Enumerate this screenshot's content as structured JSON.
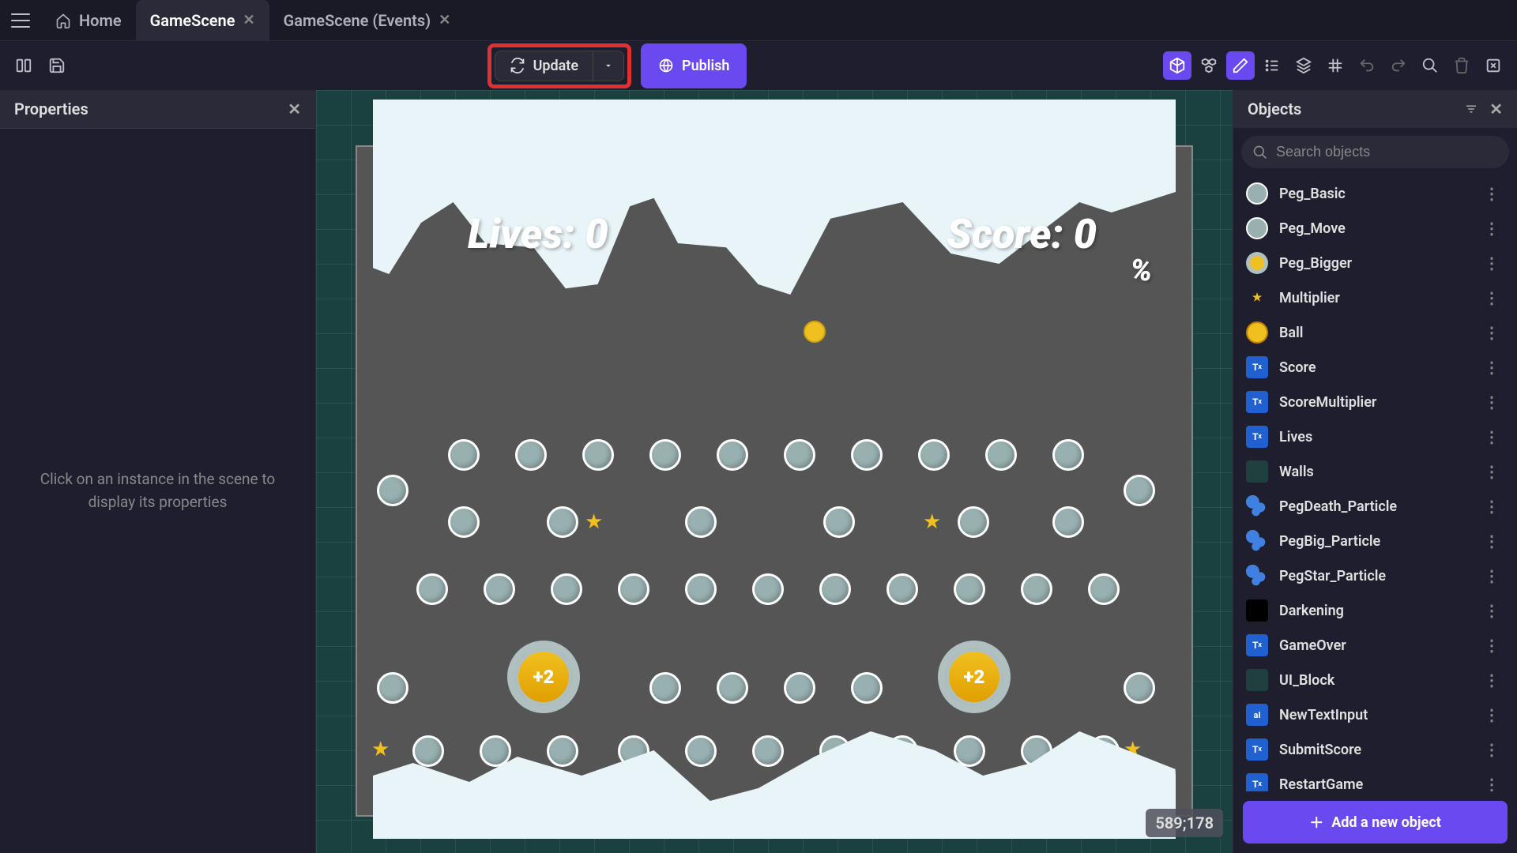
{
  "tabs": {
    "home": "Home",
    "scene": "GameScene",
    "events": "GameScene (Events)"
  },
  "toolbar": {
    "update_label": "Update",
    "publish_label": "Publish"
  },
  "properties": {
    "title": "Properties",
    "empty_hint": "Click on an instance in the scene to display its properties"
  },
  "objects_panel": {
    "title": "Objects",
    "search_placeholder": "Search objects",
    "add_label": "Add a new object",
    "items": [
      {
        "name": "Peg_Basic",
        "thumb": "peg"
      },
      {
        "name": "Peg_Move",
        "thumb": "peg"
      },
      {
        "name": "Peg_Bigger",
        "thumb": "yellow-ring"
      },
      {
        "name": "Multiplier",
        "thumb": "star"
      },
      {
        "name": "Ball",
        "thumb": "ball"
      },
      {
        "name": "Score",
        "thumb": "text"
      },
      {
        "name": "ScoreMultiplier",
        "thumb": "text"
      },
      {
        "name": "Lives",
        "thumb": "text"
      },
      {
        "name": "Walls",
        "thumb": "wall"
      },
      {
        "name": "PegDeath_Particle",
        "thumb": "particle"
      },
      {
        "name": "PegBig_Particle",
        "thumb": "particle"
      },
      {
        "name": "PegStar_Particle",
        "thumb": "particle"
      },
      {
        "name": "Darkening",
        "thumb": "dark"
      },
      {
        "name": "GameOver",
        "thumb": "text"
      },
      {
        "name": "UI_Block",
        "thumb": "wall"
      },
      {
        "name": "NewTextInput",
        "thumb": "input"
      },
      {
        "name": "SubmitScore",
        "thumb": "text"
      },
      {
        "name": "RestartGame",
        "thumb": "text"
      }
    ]
  },
  "scene": {
    "lives_text": "Lives: 0",
    "score_text": "Score: 0",
    "pct_text": "%",
    "bigger_text": "+2",
    "cursor_coord": "589;178"
  },
  "colors": {
    "accent": "#6a4af0",
    "highlight_box": "#e03030"
  }
}
